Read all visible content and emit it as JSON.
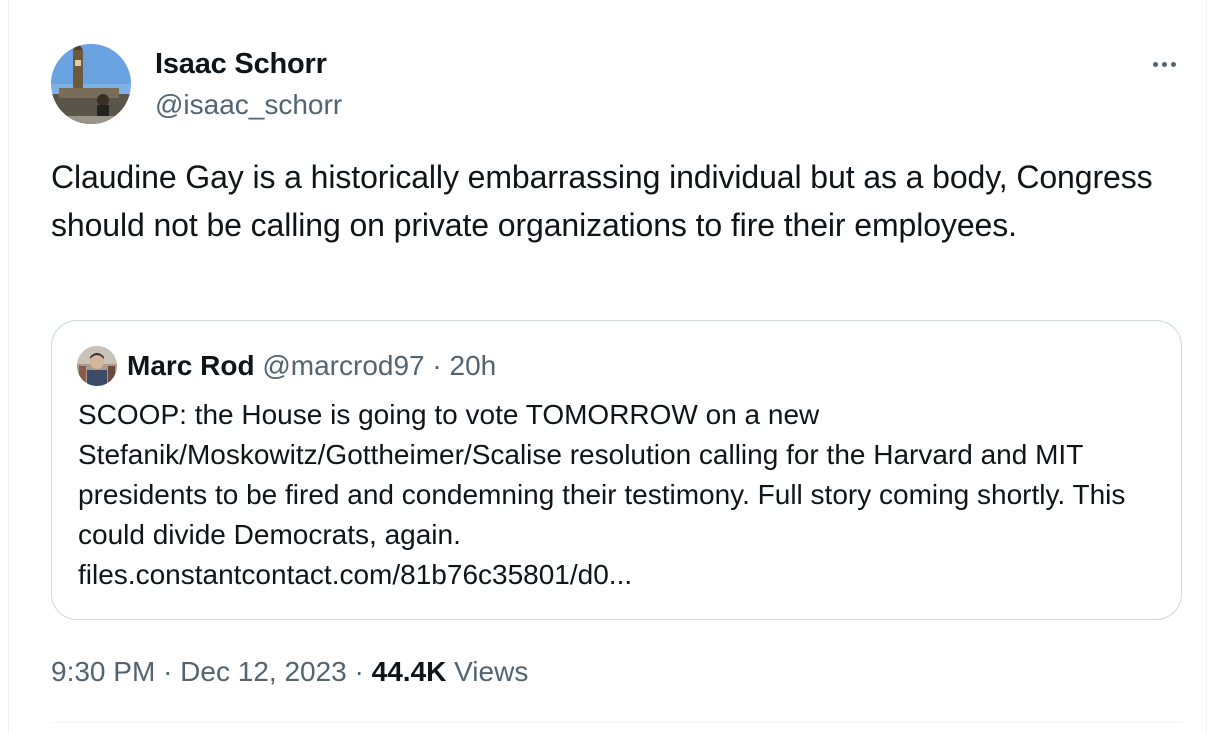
{
  "tweet": {
    "author": {
      "name": "Isaac Schorr",
      "handle": "@isaac_schorr"
    },
    "text": "Claudine Gay is a historically embarrassing individual but as a body, Congress should not be calling on private organizations to fire their employees.",
    "quoted": {
      "author_name": "Marc Rod",
      "author_handle": "@marcrod97",
      "separator": "·",
      "age": "20h",
      "text": "SCOOP: the House is going to vote TOMORROW on a new Stefanik/Moskowitz/Gottheimer/Scalise resolution calling for the Harvard and MIT presidents to be fired and condemning their testimony. Full story coming shortly. This could divide Democrats, again.",
      "link": "files.constantcontact.com/81b76c35801/d0..."
    },
    "meta": {
      "time": "9:30 PM",
      "separator": "·",
      "date": "Dec 12, 2023",
      "views_count": "44.4K",
      "views_label": "Views"
    }
  },
  "icons": {
    "more": "more-horizontal-icon"
  },
  "colors": {
    "text_primary": "#0f1419",
    "text_secondary": "#536471",
    "border": "#cfd9de"
  }
}
